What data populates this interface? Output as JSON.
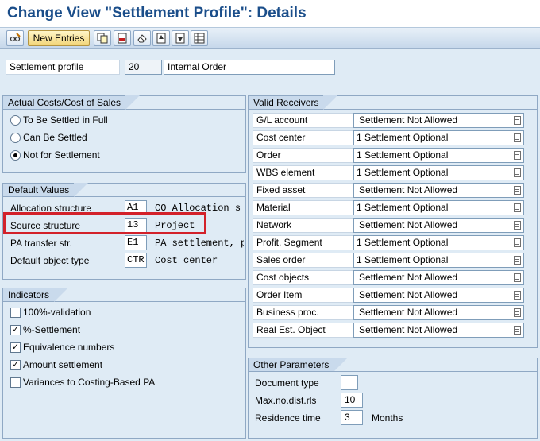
{
  "title": "Change View \"Settlement Profile\": Details",
  "toolbar": {
    "new_entries": "New Entries"
  },
  "header": {
    "label": "Settlement profile",
    "value": "20",
    "description": "Internal Order"
  },
  "actual_costs": {
    "title": "Actual Costs/Cost of Sales",
    "options": [
      {
        "label": "To Be Settled in Full",
        "selected": false
      },
      {
        "label": "Can Be Settled",
        "selected": false
      },
      {
        "label": "Not for Settlement",
        "selected": true
      }
    ]
  },
  "default_values": {
    "title": "Default Values",
    "rows": [
      {
        "label": "Allocation structure",
        "value": "A1",
        "text": "CO Allocation s"
      },
      {
        "label": "Source structure",
        "value": "13",
        "text": "Project"
      },
      {
        "label": "PA transfer str.",
        "value": "E1",
        "text": "PA settlement, p"
      },
      {
        "label": "Default object type",
        "value": "CTR",
        "text": "Cost center"
      }
    ]
  },
  "indicators": {
    "title": "Indicators",
    "items": [
      {
        "label": "100%-validation",
        "checked": false
      },
      {
        "label": "%-Settlement",
        "checked": true
      },
      {
        "label": "Equivalence numbers",
        "checked": true
      },
      {
        "label": "Amount settlement",
        "checked": true
      },
      {
        "label": "Variances to Costing-Based PA",
        "checked": false
      }
    ]
  },
  "valid_receivers": {
    "title": "Valid Receivers",
    "rows": [
      {
        "label": "G/L account",
        "value": "Settlement Not Allowed"
      },
      {
        "label": "Cost center",
        "value": "1 Settlement Optional"
      },
      {
        "label": "Order",
        "value": "1 Settlement Optional"
      },
      {
        "label": "WBS element",
        "value": "1 Settlement Optional"
      },
      {
        "label": "Fixed asset",
        "value": "Settlement Not Allowed"
      },
      {
        "label": "Material",
        "value": "1 Settlement Optional"
      },
      {
        "label": "Network",
        "value": "Settlement Not Allowed"
      },
      {
        "label": "Profit. Segment",
        "value": "1 Settlement Optional"
      },
      {
        "label": "Sales order",
        "value": "1 Settlement Optional"
      },
      {
        "label": "Cost objects",
        "value": "Settlement Not Allowed"
      },
      {
        "label": "Order Item",
        "value": "Settlement Not Allowed"
      },
      {
        "label": "Business proc.",
        "value": "Settlement Not Allowed"
      },
      {
        "label": "Real Est. Object",
        "value": "Settlement Not Allowed"
      }
    ]
  },
  "other_params": {
    "title": "Other Parameters",
    "doc_type_label": "Document type",
    "doc_type_value": "",
    "max_label": "Max.no.dist.rls",
    "max_value": "10",
    "residence_label": "Residence time",
    "residence_value": "3",
    "residence_unit": "Months"
  }
}
